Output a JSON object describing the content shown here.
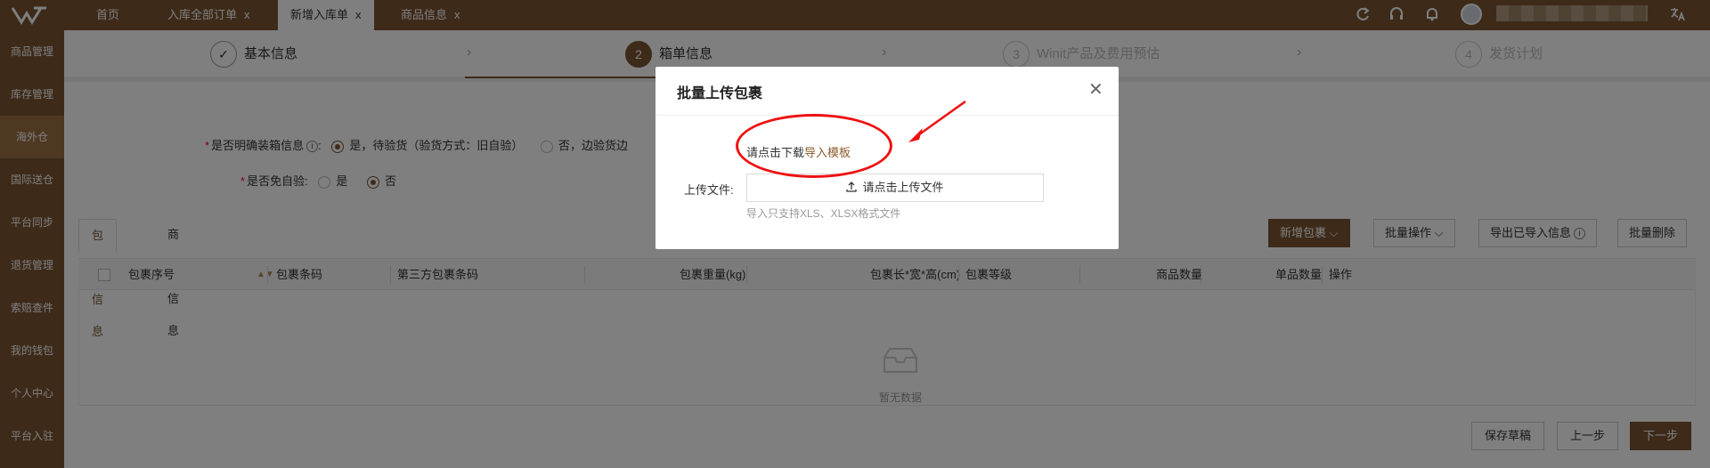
{
  "topbar": {
    "tabs": [
      {
        "label": "首页",
        "closable": false
      },
      {
        "label": "入库全部订单",
        "closable": true
      },
      {
        "label": "新增入库单",
        "closable": true,
        "active": true
      },
      {
        "label": "商品信息",
        "closable": true
      }
    ],
    "close_glyph": "x",
    "icons": [
      "refresh-icon",
      "headset-icon",
      "bell-icon",
      "translate-icon"
    ]
  },
  "sidebar": {
    "items": [
      {
        "label": "商品管理"
      },
      {
        "label": "库存管理"
      },
      {
        "label": "海外仓",
        "active": true
      },
      {
        "label": "国际送仓"
      },
      {
        "label": "平台同步"
      },
      {
        "label": "退货管理"
      },
      {
        "label": "索赔查件"
      },
      {
        "label": "我的钱包"
      },
      {
        "label": "个人中心"
      },
      {
        "label": "平台入驻"
      }
    ]
  },
  "steps": [
    {
      "number": "✓",
      "label": "基本信息",
      "status": "done"
    },
    {
      "number": "2",
      "label": "箱单信息",
      "status": "current"
    },
    {
      "number": "3",
      "label": "Winit产品及费用预估",
      "status": "pending"
    },
    {
      "number": "4",
      "label": "发货计划",
      "status": "pending"
    }
  ],
  "form": {
    "packing_label": "是否明确装箱信息",
    "packing_opt_yes": "是，待验货（验货方式：旧自验）",
    "packing_opt_no": "否，边验货边",
    "inspect_label": "是否免自验",
    "inspect_opt_yes": "是",
    "inspect_opt_no": "否",
    "packing_selected": "yes",
    "inspect_selected": "no"
  },
  "inner_tabs": [
    "包裹信息",
    "商品信息"
  ],
  "actions": {
    "add_package": "新增包裹",
    "batch_ops": "批量操作",
    "export_imported": "导出已导入信息",
    "batch_delete": "批量删除"
  },
  "table": {
    "columns": [
      "包裹序号",
      "包裹条码",
      "第三方包裹条码",
      "包裹重量(kg)",
      "包裹长*宽*高(cm)",
      "包裹等级",
      "商品数量",
      "单品数量",
      "操作"
    ],
    "empty_text": "暂无数据"
  },
  "footer": {
    "save_draft": "保存草稿",
    "prev": "上一步",
    "next": "下一步"
  },
  "modal": {
    "title": "批量上传包裹",
    "download_prefix": "请点击下载",
    "download_link": "导入模板",
    "upload_label": "上传文件:",
    "upload_button": "请点击上传文件",
    "upload_hint": "导入只支持XLS、XLSX格式文件"
  },
  "colors": {
    "brand": "#7a5532",
    "annotation": "#e11111"
  }
}
